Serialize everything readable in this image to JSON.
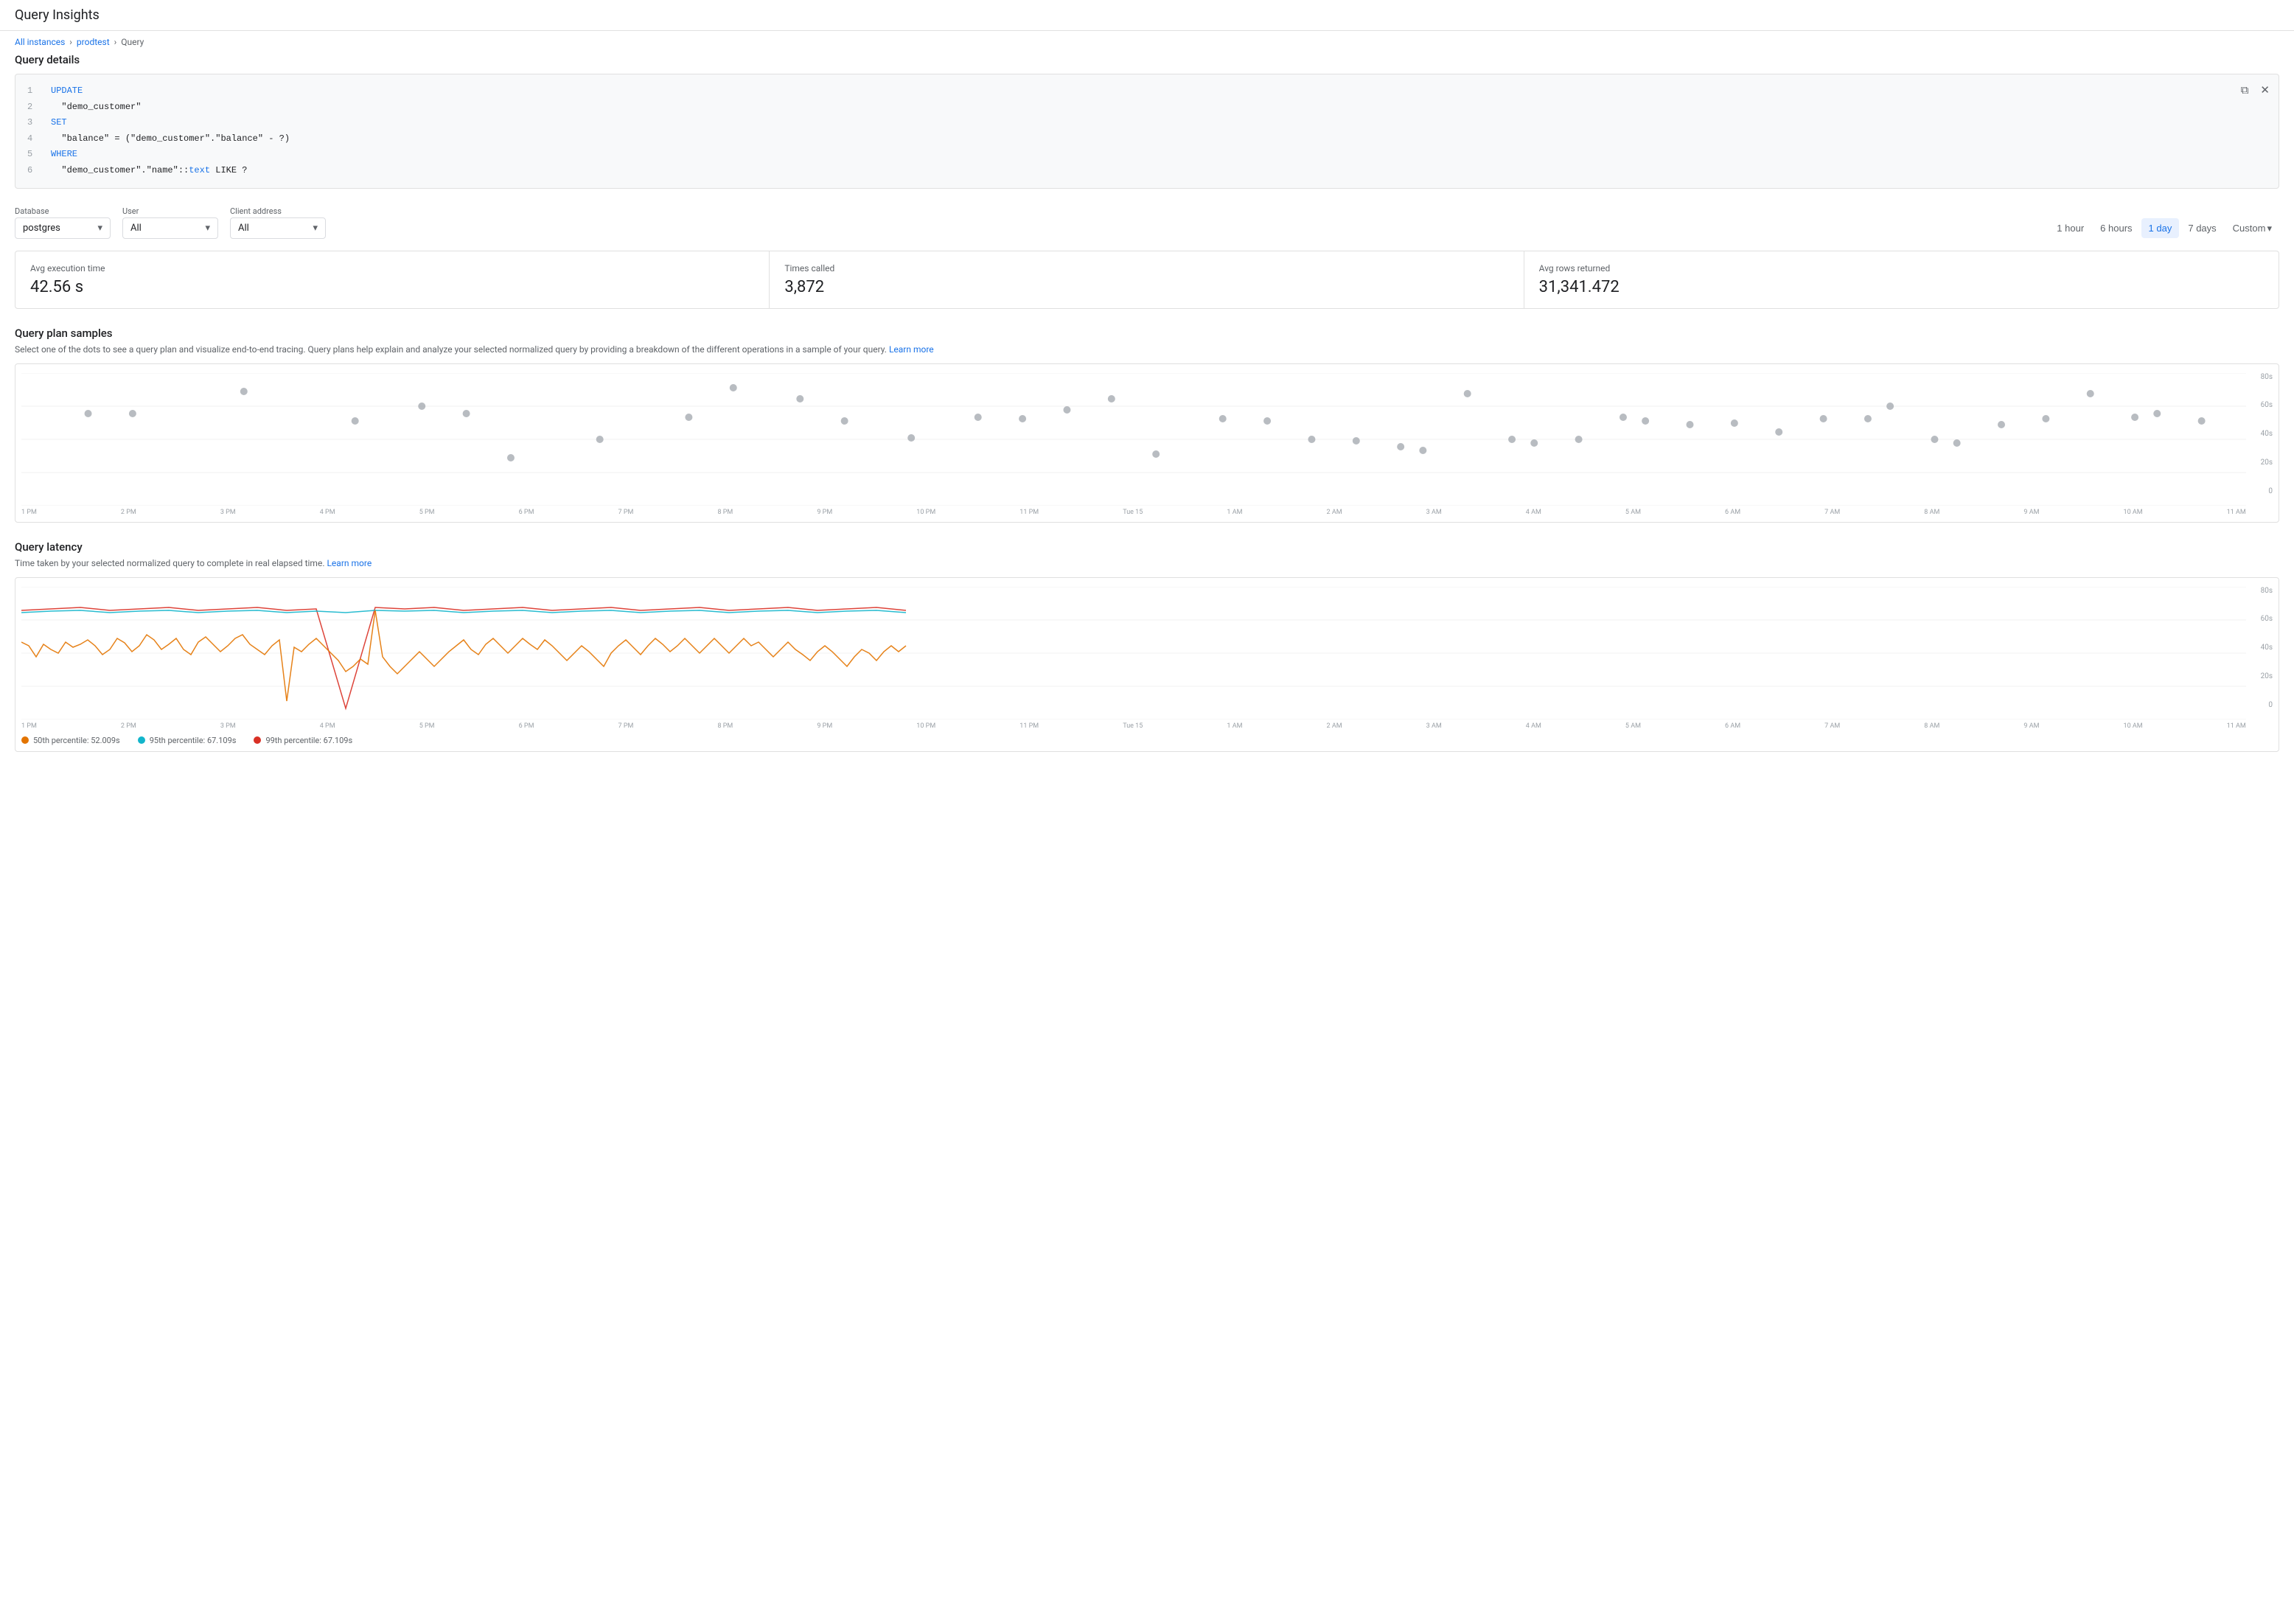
{
  "app": {
    "title": "Query Insights"
  },
  "breadcrumb": {
    "items": [
      {
        "label": "All instances",
        "link": true
      },
      {
        "label": "prodtest",
        "link": true
      },
      {
        "label": "Query",
        "link": false
      }
    ]
  },
  "query_details": {
    "title": "Query details",
    "code_lines": [
      {
        "num": "1",
        "content": "UPDATE",
        "type": "keyword"
      },
      {
        "num": "2",
        "content": "  \"demo_customer\"",
        "type": "string"
      },
      {
        "num": "3",
        "content": "SET",
        "type": "keyword"
      },
      {
        "num": "4",
        "content": "  \"balance\" = (\"demo_customer\".\"balance\" - ?)",
        "type": "string"
      },
      {
        "num": "5",
        "content": "WHERE",
        "type": "keyword"
      },
      {
        "num": "6",
        "content": "  \"demo_customer\".\"name\"::text LIKE ?",
        "type": "mixed"
      }
    ]
  },
  "filters": {
    "database": {
      "label": "Database",
      "value": "postgres"
    },
    "user": {
      "label": "User",
      "value": "All"
    },
    "client_address": {
      "label": "Client address",
      "value": "All"
    }
  },
  "time_range": {
    "options": [
      "1 hour",
      "6 hours",
      "1 day",
      "7 days"
    ],
    "active": "1 day",
    "custom_label": "Custom"
  },
  "metrics": [
    {
      "label": "Avg execution time",
      "value": "42.56 s"
    },
    {
      "label": "Times called",
      "value": "3,872"
    },
    {
      "label": "Avg rows returned",
      "value": "31,341.472"
    }
  ],
  "query_plan": {
    "title": "Query plan samples",
    "description": "Select one of the dots to see a query plan and visualize end-to-end tracing. Query plans help explain and analyze your selected normalized query by providing a breakdown of the different operations in a sample of your query.",
    "learn_more": "Learn more",
    "y_labels": [
      "80s",
      "60s",
      "40s",
      "20s",
      "0"
    ],
    "x_labels": [
      "1 PM",
      "2 PM",
      "3 PM",
      "4 PM",
      "5 PM",
      "6 PM",
      "7 PM",
      "8 PM",
      "9 PM",
      "10 PM",
      "11 PM",
      "Tue 15",
      "1 AM",
      "2 AM",
      "3 AM",
      "4 AM",
      "5 AM",
      "6 AM",
      "7 AM",
      "8 AM",
      "9 AM",
      "10 AM",
      "11 AM"
    ]
  },
  "query_latency": {
    "title": "Query latency",
    "description": "Time taken by your selected normalized query to complete in real elapsed time.",
    "learn_more": "Learn more",
    "y_labels": [
      "80s",
      "60s",
      "40s",
      "20s",
      "0"
    ],
    "x_labels": [
      "1 PM",
      "2 PM",
      "3 PM",
      "4 PM",
      "5 PM",
      "6 PM",
      "7 PM",
      "8 PM",
      "9 PM",
      "10 PM",
      "11 PM",
      "Tue 15",
      "1 AM",
      "2 AM",
      "3 AM",
      "4 AM",
      "5 AM",
      "6 AM",
      "7 AM",
      "8 AM",
      "9 AM",
      "10 AM",
      "11 AM"
    ],
    "legend": [
      {
        "label": "50th percentile: 52.009s",
        "color": "#e37400"
      },
      {
        "label": "95th percentile: 67.109s",
        "color": "#12b5cb"
      },
      {
        "label": "99th percentile: 67.109s",
        "color": "#d93025"
      }
    ]
  },
  "icons": {
    "copy": "⧉",
    "close": "✕",
    "chevron_down": "▾"
  }
}
